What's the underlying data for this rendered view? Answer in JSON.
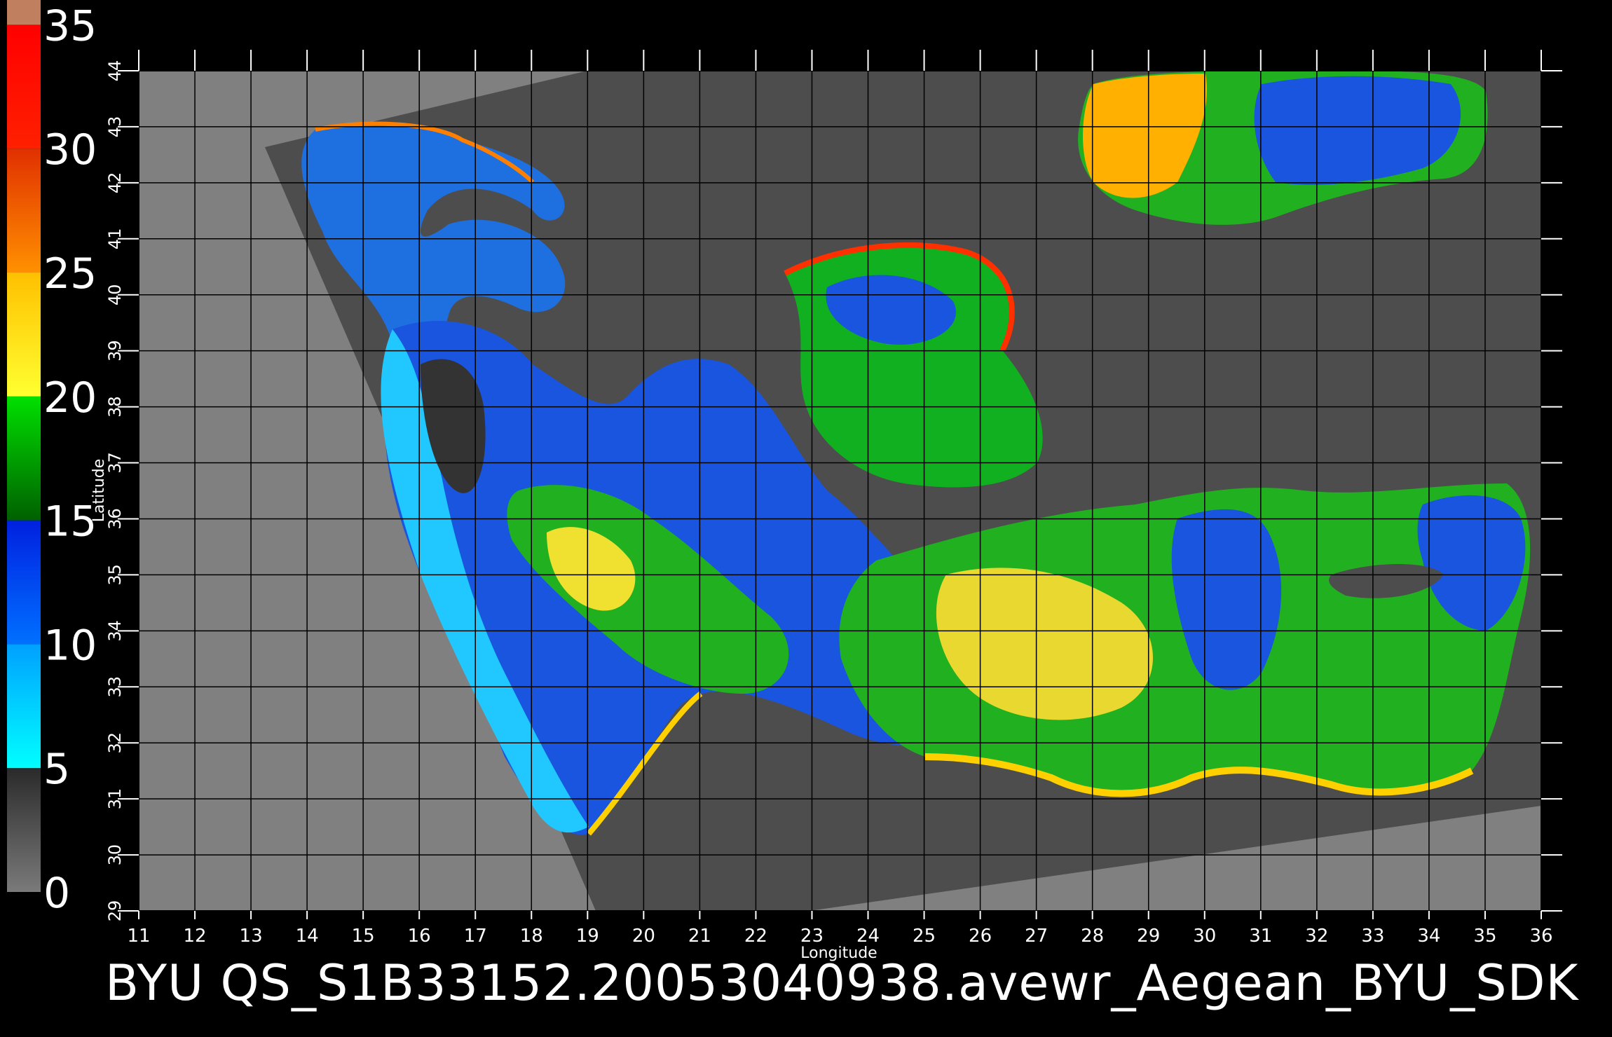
{
  "title": "BYU  QS_S1B33152.20053040938.avewr_Aegean_BYU_SDK",
  "xlabel": "Longitude",
  "ylabel": "Latitude",
  "longitude_ticks": [
    "11",
    "12",
    "13",
    "14",
    "15",
    "16",
    "17",
    "18",
    "19",
    "20",
    "21",
    "22",
    "23",
    "24",
    "25",
    "26",
    "27",
    "28",
    "29",
    "30",
    "31",
    "32",
    "33",
    "34",
    "35",
    "36"
  ],
  "latitude_ticks": [
    "29",
    "30",
    "31",
    "32",
    "33",
    "34",
    "35",
    "36",
    "37",
    "38",
    "39",
    "40",
    "41",
    "42",
    "43",
    "44"
  ],
  "colorbar": {
    "labels": [
      "0",
      "5",
      "10",
      "15",
      "20",
      "25",
      "30",
      "35"
    ],
    "segments": [
      {
        "from": 0,
        "to": 5,
        "colors": [
          "#7a7a7a",
          "#2a2a2a"
        ]
      },
      {
        "from": 5,
        "to": 10,
        "colors": [
          "#00ffff",
          "#00a0ff"
        ]
      },
      {
        "from": 10,
        "to": 15,
        "colors": [
          "#0070ff",
          "#0020e0"
        ]
      },
      {
        "from": 15,
        "to": 20,
        "colors": [
          "#006000",
          "#00e000"
        ]
      },
      {
        "from": 20,
        "to": 25,
        "colors": [
          "#ffff30",
          "#ffc000"
        ]
      },
      {
        "from": 25,
        "to": 30,
        "colors": [
          "#ff9000",
          "#e03000"
        ]
      },
      {
        "from": 30,
        "to": 35,
        "colors": [
          "#ff2000",
          "#ff0000"
        ]
      },
      {
        "from": 35,
        "to": 36,
        "colors": [
          "#c08060",
          "#c08060"
        ]
      }
    ]
  },
  "colors": {
    "background": "#000000",
    "land_outside": "#808080",
    "swath_land": "#4d4d4d",
    "grid": "#000000"
  },
  "map": {
    "lon_range": [
      11,
      36
    ],
    "lat_range": [
      29,
      44
    ]
  }
}
